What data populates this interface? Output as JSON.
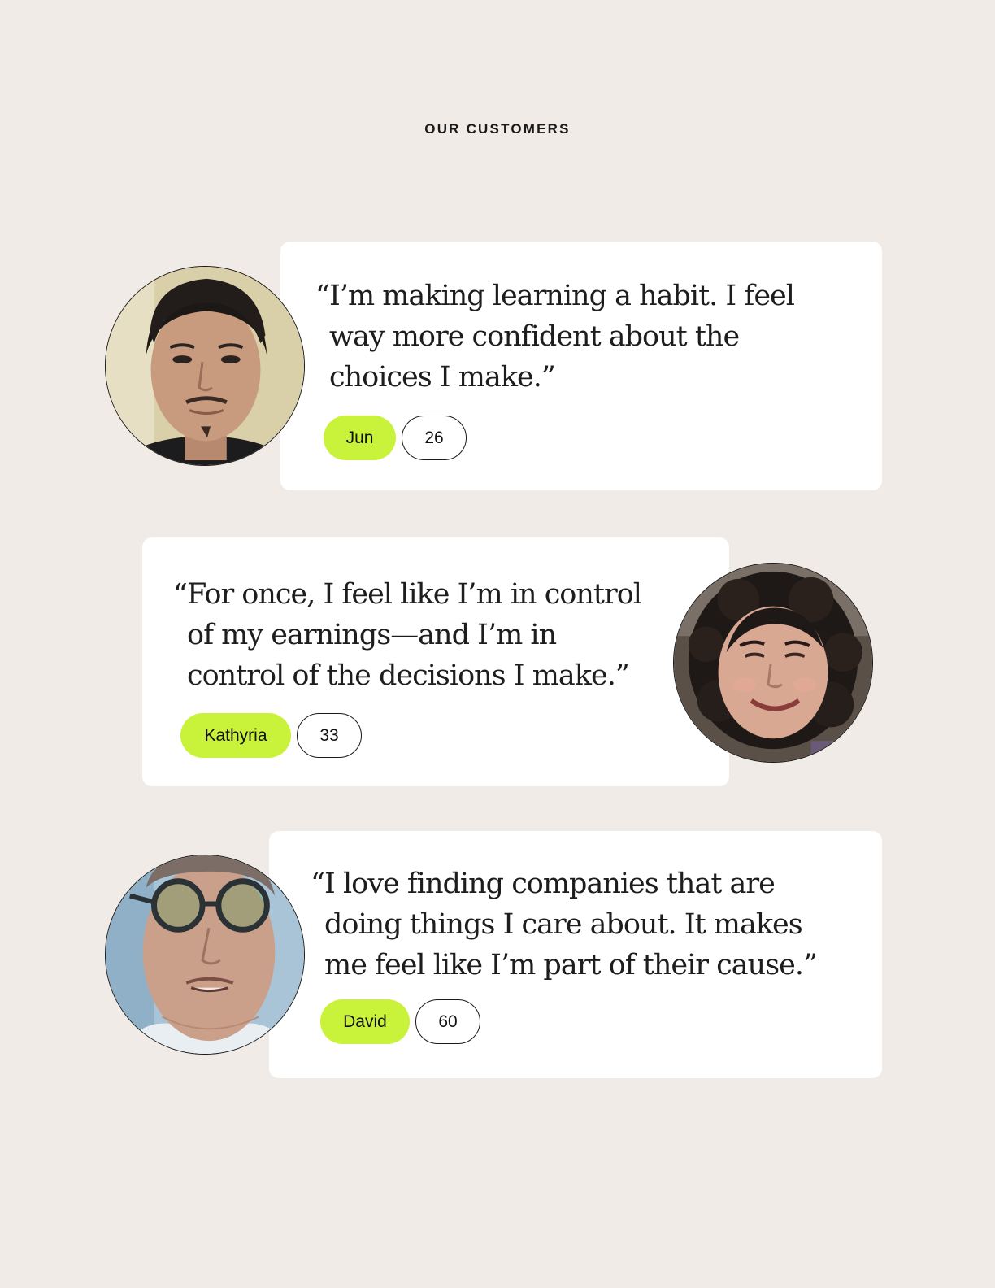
{
  "header": {
    "section_label": "OUR CUSTOMERS"
  },
  "testimonials": [
    {
      "quote_lines": [
        "I’m making learning a habit. I feel",
        "way more confident about the",
        "choices I make.”"
      ],
      "open_quote": "“",
      "name": "Jun",
      "age": "26"
    },
    {
      "quote_lines": [
        "For once, I feel like I’m in control",
        "of my earnings—and I’m in",
        "control of the decisions I make.”"
      ],
      "open_quote": "“",
      "name": "Kathyria",
      "age": "33"
    },
    {
      "quote_lines": [
        "I love finding companies that are",
        "doing things I care about. It makes",
        "me feel like I’m part of their cause.”"
      ],
      "open_quote": "“",
      "name": "David",
      "age": "60"
    }
  ],
  "colors": {
    "background": "#f0ebe6",
    "card": "#ffffff",
    "name_tag": "#c9f23b",
    "text": "#1a1a1a"
  },
  "icons": {
    "avatar_1": "customer-photo-jun",
    "avatar_2": "customer-photo-kathyria",
    "avatar_3": "customer-photo-david"
  }
}
